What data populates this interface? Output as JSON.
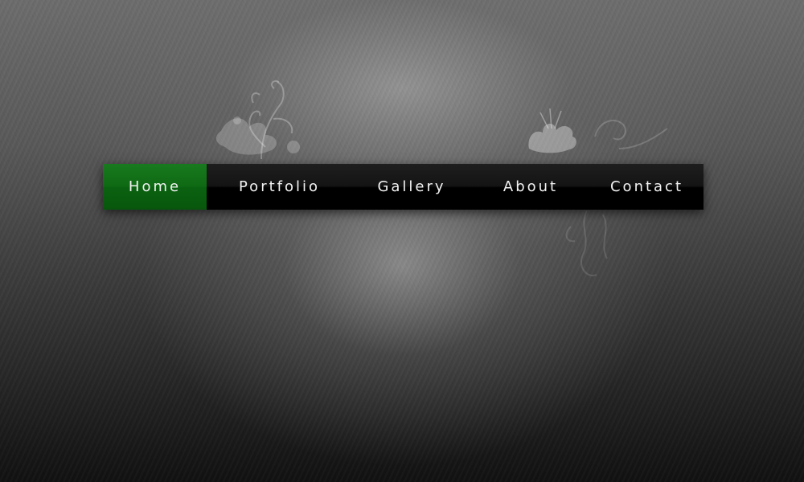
{
  "nav": {
    "active_index": 0,
    "active_color": "#0f6a14",
    "bar_color": "#000000",
    "items": [
      {
        "label": "Home"
      },
      {
        "label": "Portfolio"
      },
      {
        "label": "Gallery"
      },
      {
        "label": "About"
      },
      {
        "label": "Contact"
      }
    ]
  },
  "background": {
    "decoration_icons": [
      "floral-ornament-icon",
      "flower-ornament-icon",
      "swirl-ornament-icon"
    ]
  }
}
